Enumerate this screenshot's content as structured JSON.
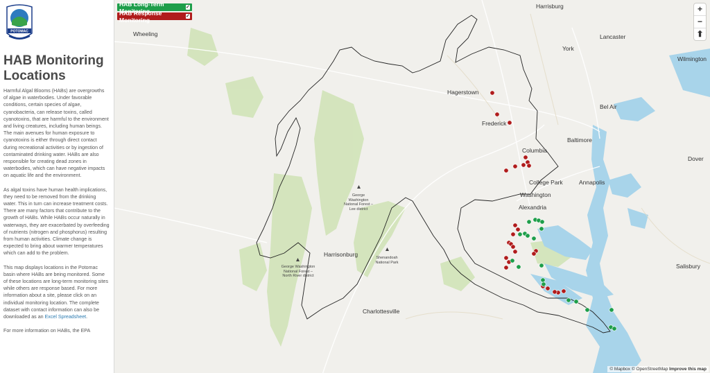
{
  "sidebar": {
    "logo_text": "POTOMAC",
    "title_line1": "HAB Monitoring",
    "title_line2": "Locations",
    "para1": "Harmful Algal Blooms (HABs) are overgrowths of algae in waterbodies. Under favorable conditions, certain species of algae, cyanobacteria, can release toxins, called cyanotoxins, that are harmful to the environment and living creatures, including human beings. The main avenues for human exposure to cyanotoxins is either through direct contact during recreational activities or by ingestion of contaminated drinking water. HABs are also responsible for creating dead zones in waterbodies, which can have negative impacts on aquatic life and the environment.",
    "para2": "As algal toxins have human health implications, they need to be removed from the drinking water. This in turn can increase treatment costs. There are many factors that contribute to the growth of HABs. While HABs occur naturally in waterways, they are exacerbated by overfeeding of nutrients (nitrogen and phosphorus) resulting from human activities. Climate change is expected to bring about warmer temperatures which can add to the problem.",
    "para3_pre": "This map displays locations in the Potomac basin where HABs are being monitored. Some of these locations are long-term monitoring sites while others are response based. For more information about a site, please click on an individual monitoring location. The complete dataset with contact information can also be downloaded as an ",
    "para3_link": "Excel Spreadsheet",
    "para3_post": ".",
    "para4": "For more information on HABs, the EPA"
  },
  "legend": {
    "long_term": "HAB Long-Term Monitoring",
    "response": "HAB Response Monitoring",
    "long_term_color": "#1e9e4a",
    "response_color": "#b01c1c"
  },
  "zoom": {
    "in": "+",
    "out": "−",
    "reset": "⬆"
  },
  "attribution": {
    "mapbox": "© Mapbox",
    "osm": "© OpenStreetMap",
    "improve": "Improve this map"
  },
  "cities": {
    "harrisburg": "Harrisburg",
    "wheeling": "Wheeling",
    "lancaster": "Lancaster",
    "york": "York",
    "wilmington": "Wilmington",
    "hagerstown": "Hagerstown",
    "bel_air": "Bel Air",
    "frederick": "Frederick",
    "baltimore": "Baltimore",
    "columbia": "Columbia",
    "dover": "Dover",
    "college_park": "College Park",
    "annapolis": "Annapolis",
    "washington": "Washington",
    "alexandria": "Alexandria",
    "harrisonburg": "Harrisonburg",
    "salisbury": "Salisbury",
    "charlottesville": "Charlottesville"
  },
  "parks": {
    "gw_lee": "George Washington National Forest – Lee district",
    "shenandoah": "Shenandoah National Park",
    "gw_north": "George Washington National Forest – North River district"
  }
}
